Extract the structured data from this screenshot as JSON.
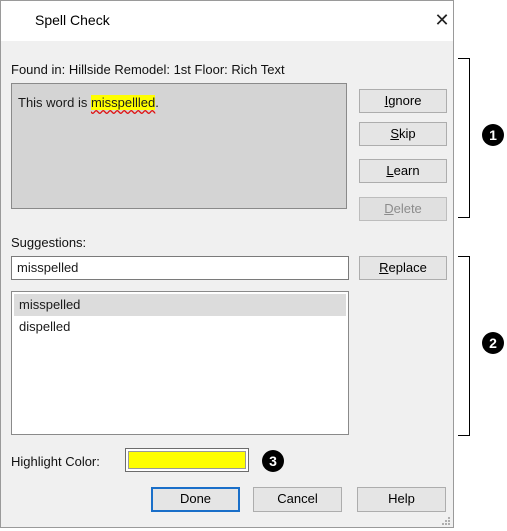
{
  "window": {
    "title": "Spell Check",
    "close_glyph": "✕"
  },
  "found_in": "Found in: Hillside Remodel: 1st Floor: Rich Text",
  "context": {
    "text_before": "This word is ",
    "misspelled": "misspellled",
    "text_after": ".",
    "highlight_color": "#ffff00"
  },
  "actions": {
    "ignore": {
      "mnemonic": "I",
      "rest": "gnore"
    },
    "skip": {
      "mnemonic": "S",
      "rest": "kip"
    },
    "learn": {
      "mnemonic": "L",
      "rest": "earn"
    },
    "delete": {
      "mnemonic": "D",
      "rest": "elete",
      "disabled": true
    }
  },
  "suggestions": {
    "label": "Suggestions:",
    "input_value": "misspelled",
    "replace": {
      "mnemonic": "R",
      "rest": "eplace"
    },
    "items": [
      {
        "text": "misspelled",
        "selected": true
      },
      {
        "text": "dispelled",
        "selected": false
      }
    ]
  },
  "highlight": {
    "label": "Highlight Color:",
    "color": "#ffff00"
  },
  "footer": {
    "done": "Done",
    "cancel": "Cancel",
    "help": "Help"
  },
  "callouts": [
    "1",
    "2",
    "3"
  ]
}
